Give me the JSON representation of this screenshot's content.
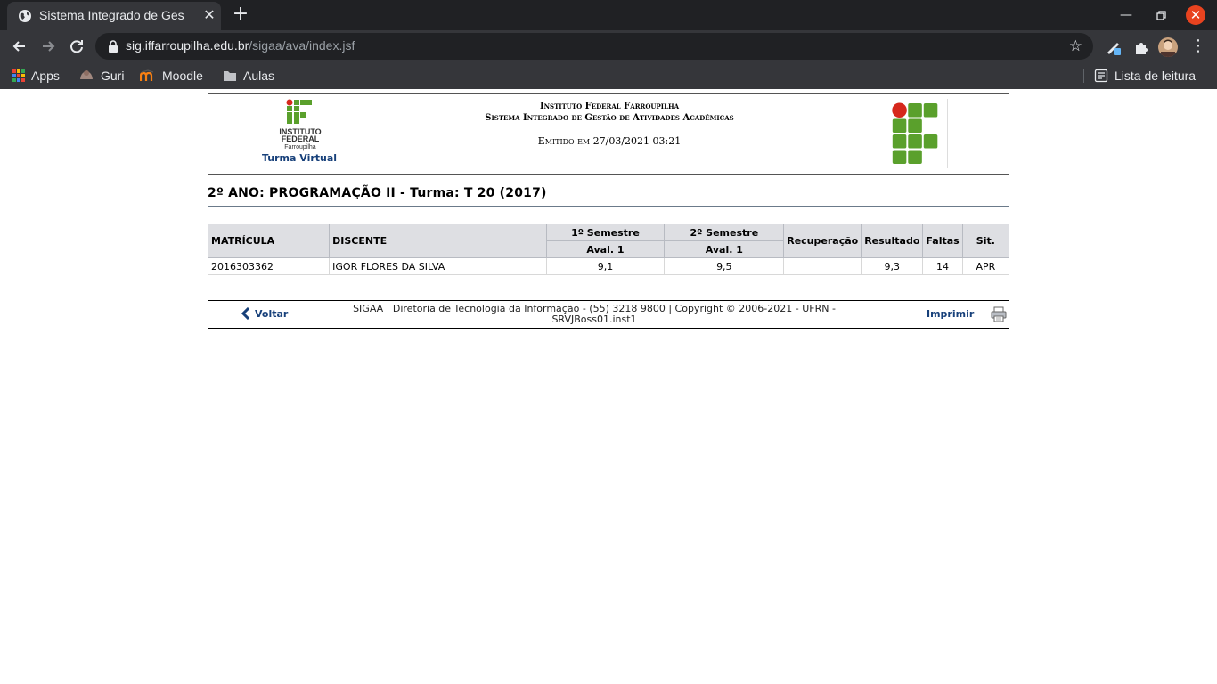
{
  "browser": {
    "tab_title": "Sistema Integrado de Ges",
    "url_host": "sig.iffarroupilha.edu.br",
    "url_path": "/sigaa/ava/index.jsf",
    "bookmarks": [
      {
        "label": "Apps",
        "icon": "apps-grid-icon"
      },
      {
        "label": "Guri",
        "icon": "guri-icon"
      },
      {
        "label": "Moodle",
        "icon": "moodle-icon"
      },
      {
        "label": "Aulas",
        "icon": "folder-icon"
      }
    ],
    "reading_list_label": "Lista de leitura"
  },
  "header": {
    "logo_text_line1": "INSTITUTO",
    "logo_text_line2": "FEDERAL",
    "logo_text_line3": "Farroupilha",
    "turma_virtual": "Turma Virtual",
    "institution": "Instituto Federal Farroupilha",
    "system": "Sistema Integrado de Gestão de Atividades Acadêmicas",
    "emitted": "Emitido em 27/03/2021 03:21"
  },
  "course": {
    "title": "2º ANO: PROGRAMAÇÃO II - Turma: T 20 (2017)"
  },
  "table": {
    "headers": {
      "matricula": "MATRÍCULA",
      "discente": "DISCENTE",
      "sem1": "1º Semestre",
      "sem2": "2º Semestre",
      "recuperacao": "Recuperação",
      "resultado": "Resultado",
      "faltas": "Faltas",
      "situacao": "Sit.",
      "aval1_sem1": "Aval. 1",
      "aval1_sem2": "Aval. 1"
    },
    "rows": [
      {
        "matricula": "2016303362",
        "discente": "IGOR FLORES DA SILVA",
        "sem1": "9,1",
        "sem2": "9,5",
        "recuperacao": "",
        "resultado": "9,3",
        "faltas": "14",
        "situacao": "APR"
      }
    ]
  },
  "footer": {
    "back_label": "Voltar",
    "line1": "SIGAA | Diretoria de Tecnologia da Informação - (55) 3218 9800 | Copyright © 2006-2021 - UFRN -",
    "line2": "SRVJBoss01.inst1",
    "print_label": "Imprimir"
  },
  "colors": {
    "if_green": "#5aa02c",
    "if_red": "#d6281c",
    "link_blue": "#17407a",
    "header_gray": "#dedfe3"
  }
}
